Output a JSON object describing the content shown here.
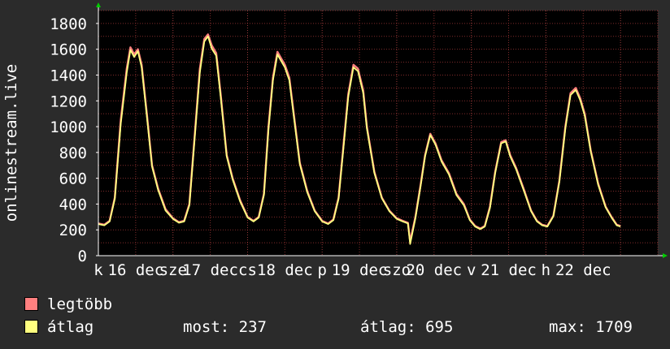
{
  "chart_data": {
    "type": "area",
    "ylabel": "onlinestream.live",
    "ylim": [
      0,
      1900
    ],
    "yticks": [
      0,
      200,
      400,
      600,
      800,
      1000,
      1200,
      1400,
      1600,
      1800
    ],
    "grid": true,
    "x_labels": [
      "k",
      "16 dec",
      "sze",
      "17 dec",
      "cs",
      "18 dec",
      "p",
      "19 dec",
      "szo",
      "20 dec",
      "v",
      "21 dec",
      "h",
      "22 dec"
    ],
    "x_range": [
      0,
      7.5
    ],
    "series": [
      {
        "name": "legtöbb",
        "color": "#ff7f7f",
        "points": [
          [
            0.0,
            250
          ],
          [
            0.08,
            240
          ],
          [
            0.15,
            270
          ],
          [
            0.22,
            450
          ],
          [
            0.3,
            1050
          ],
          [
            0.38,
            1450
          ],
          [
            0.43,
            1615
          ],
          [
            0.48,
            1560
          ],
          [
            0.53,
            1600
          ],
          [
            0.58,
            1480
          ],
          [
            0.65,
            1100
          ],
          [
            0.72,
            700
          ],
          [
            0.8,
            520
          ],
          [
            0.9,
            360
          ],
          [
            1.0,
            290
          ],
          [
            1.08,
            260
          ],
          [
            1.15,
            270
          ],
          [
            1.22,
            400
          ],
          [
            1.3,
            1000
          ],
          [
            1.36,
            1450
          ],
          [
            1.42,
            1680
          ],
          [
            1.47,
            1715
          ],
          [
            1.52,
            1630
          ],
          [
            1.58,
            1570
          ],
          [
            1.64,
            1250
          ],
          [
            1.72,
            780
          ],
          [
            1.8,
            600
          ],
          [
            1.9,
            430
          ],
          [
            2.0,
            300
          ],
          [
            2.08,
            270
          ],
          [
            2.15,
            300
          ],
          [
            2.22,
            480
          ],
          [
            2.28,
            1000
          ],
          [
            2.34,
            1380
          ],
          [
            2.4,
            1580
          ],
          [
            2.45,
            1530
          ],
          [
            2.5,
            1480
          ],
          [
            2.56,
            1380
          ],
          [
            2.62,
            1100
          ],
          [
            2.7,
            720
          ],
          [
            2.8,
            500
          ],
          [
            2.9,
            350
          ],
          [
            3.0,
            270
          ],
          [
            3.08,
            250
          ],
          [
            3.15,
            280
          ],
          [
            3.22,
            450
          ],
          [
            3.28,
            820
          ],
          [
            3.35,
            1250
          ],
          [
            3.42,
            1480
          ],
          [
            3.48,
            1450
          ],
          [
            3.55,
            1280
          ],
          [
            3.6,
            1000
          ],
          [
            3.7,
            650
          ],
          [
            3.8,
            450
          ],
          [
            3.9,
            350
          ],
          [
            4.0,
            290
          ],
          [
            4.08,
            270
          ],
          [
            4.15,
            255
          ],
          [
            4.18,
            110
          ],
          [
            4.25,
            300
          ],
          [
            4.32,
            550
          ],
          [
            4.38,
            780
          ],
          [
            4.45,
            945
          ],
          [
            4.52,
            870
          ],
          [
            4.6,
            740
          ],
          [
            4.7,
            640
          ],
          [
            4.8,
            480
          ],
          [
            4.9,
            400
          ],
          [
            4.98,
            280
          ],
          [
            5.05,
            230
          ],
          [
            5.12,
            210
          ],
          [
            5.18,
            230
          ],
          [
            5.25,
            380
          ],
          [
            5.32,
            650
          ],
          [
            5.4,
            880
          ],
          [
            5.46,
            895
          ],
          [
            5.52,
            780
          ],
          [
            5.6,
            680
          ],
          [
            5.7,
            520
          ],
          [
            5.8,
            350
          ],
          [
            5.88,
            270
          ],
          [
            5.95,
            240
          ],
          [
            6.02,
            230
          ],
          [
            6.1,
            310
          ],
          [
            6.18,
            580
          ],
          [
            6.26,
            1000
          ],
          [
            6.33,
            1260
          ],
          [
            6.4,
            1300
          ],
          [
            6.46,
            1220
          ],
          [
            6.52,
            1100
          ],
          [
            6.6,
            820
          ],
          [
            6.7,
            560
          ],
          [
            6.8,
            380
          ],
          [
            6.88,
            300
          ],
          [
            6.95,
            240
          ],
          [
            7.0,
            230
          ]
        ]
      },
      {
        "name": "átlag",
        "color": "#ffff7f",
        "points": [
          [
            0.0,
            245
          ],
          [
            0.08,
            235
          ],
          [
            0.15,
            265
          ],
          [
            0.22,
            440
          ],
          [
            0.3,
            1020
          ],
          [
            0.38,
            1420
          ],
          [
            0.43,
            1595
          ],
          [
            0.48,
            1540
          ],
          [
            0.53,
            1585
          ],
          [
            0.58,
            1460
          ],
          [
            0.65,
            1080
          ],
          [
            0.72,
            690
          ],
          [
            0.8,
            510
          ],
          [
            0.9,
            350
          ],
          [
            1.0,
            285
          ],
          [
            1.08,
            255
          ],
          [
            1.15,
            265
          ],
          [
            1.22,
            390
          ],
          [
            1.3,
            980
          ],
          [
            1.36,
            1420
          ],
          [
            1.42,
            1660
          ],
          [
            1.47,
            1700
          ],
          [
            1.52,
            1605
          ],
          [
            1.58,
            1550
          ],
          [
            1.64,
            1230
          ],
          [
            1.72,
            770
          ],
          [
            1.8,
            590
          ],
          [
            1.9,
            420
          ],
          [
            2.0,
            295
          ],
          [
            2.08,
            265
          ],
          [
            2.15,
            295
          ],
          [
            2.22,
            470
          ],
          [
            2.28,
            980
          ],
          [
            2.34,
            1360
          ],
          [
            2.4,
            1560
          ],
          [
            2.45,
            1510
          ],
          [
            2.5,
            1460
          ],
          [
            2.56,
            1360
          ],
          [
            2.62,
            1080
          ],
          [
            2.7,
            710
          ],
          [
            2.8,
            490
          ],
          [
            2.9,
            345
          ],
          [
            3.0,
            265
          ],
          [
            3.08,
            245
          ],
          [
            3.15,
            275
          ],
          [
            3.22,
            440
          ],
          [
            3.28,
            800
          ],
          [
            3.35,
            1230
          ],
          [
            3.42,
            1460
          ],
          [
            3.48,
            1430
          ],
          [
            3.55,
            1260
          ],
          [
            3.6,
            985
          ],
          [
            3.7,
            640
          ],
          [
            3.8,
            445
          ],
          [
            3.9,
            345
          ],
          [
            4.0,
            285
          ],
          [
            4.08,
            265
          ],
          [
            4.15,
            250
          ],
          [
            4.18,
            90
          ],
          [
            4.25,
            290
          ],
          [
            4.32,
            540
          ],
          [
            4.38,
            770
          ],
          [
            4.45,
            935
          ],
          [
            4.52,
            860
          ],
          [
            4.6,
            730
          ],
          [
            4.7,
            630
          ],
          [
            4.8,
            470
          ],
          [
            4.9,
            390
          ],
          [
            4.98,
            275
          ],
          [
            5.05,
            225
          ],
          [
            5.12,
            205
          ],
          [
            5.18,
            225
          ],
          [
            5.25,
            370
          ],
          [
            5.32,
            640
          ],
          [
            5.4,
            870
          ],
          [
            5.46,
            885
          ],
          [
            5.52,
            770
          ],
          [
            5.6,
            670
          ],
          [
            5.7,
            510
          ],
          [
            5.8,
            345
          ],
          [
            5.88,
            265
          ],
          [
            5.95,
            235
          ],
          [
            6.02,
            225
          ],
          [
            6.1,
            305
          ],
          [
            6.18,
            570
          ],
          [
            6.26,
            985
          ],
          [
            6.33,
            1245
          ],
          [
            6.4,
            1285
          ],
          [
            6.46,
            1205
          ],
          [
            6.52,
            1085
          ],
          [
            6.6,
            810
          ],
          [
            6.7,
            550
          ],
          [
            6.8,
            375
          ],
          [
            6.88,
            295
          ],
          [
            6.95,
            235
          ],
          [
            7.0,
            225
          ]
        ]
      }
    ]
  },
  "legend": {
    "items": [
      {
        "label": "legtöbb",
        "color": "#ff7f7f"
      },
      {
        "label": "átlag",
        "color": "#ffff7f"
      }
    ],
    "stats": {
      "most": "most: 237",
      "atlag": "átlag: 695",
      "max": "max: 1709"
    }
  },
  "colors": {
    "background": "#2b2b2b",
    "plot_background": "#000000",
    "grid": "#7f2b2b",
    "axis": "#ffffff",
    "arrow": "#00cc00"
  }
}
